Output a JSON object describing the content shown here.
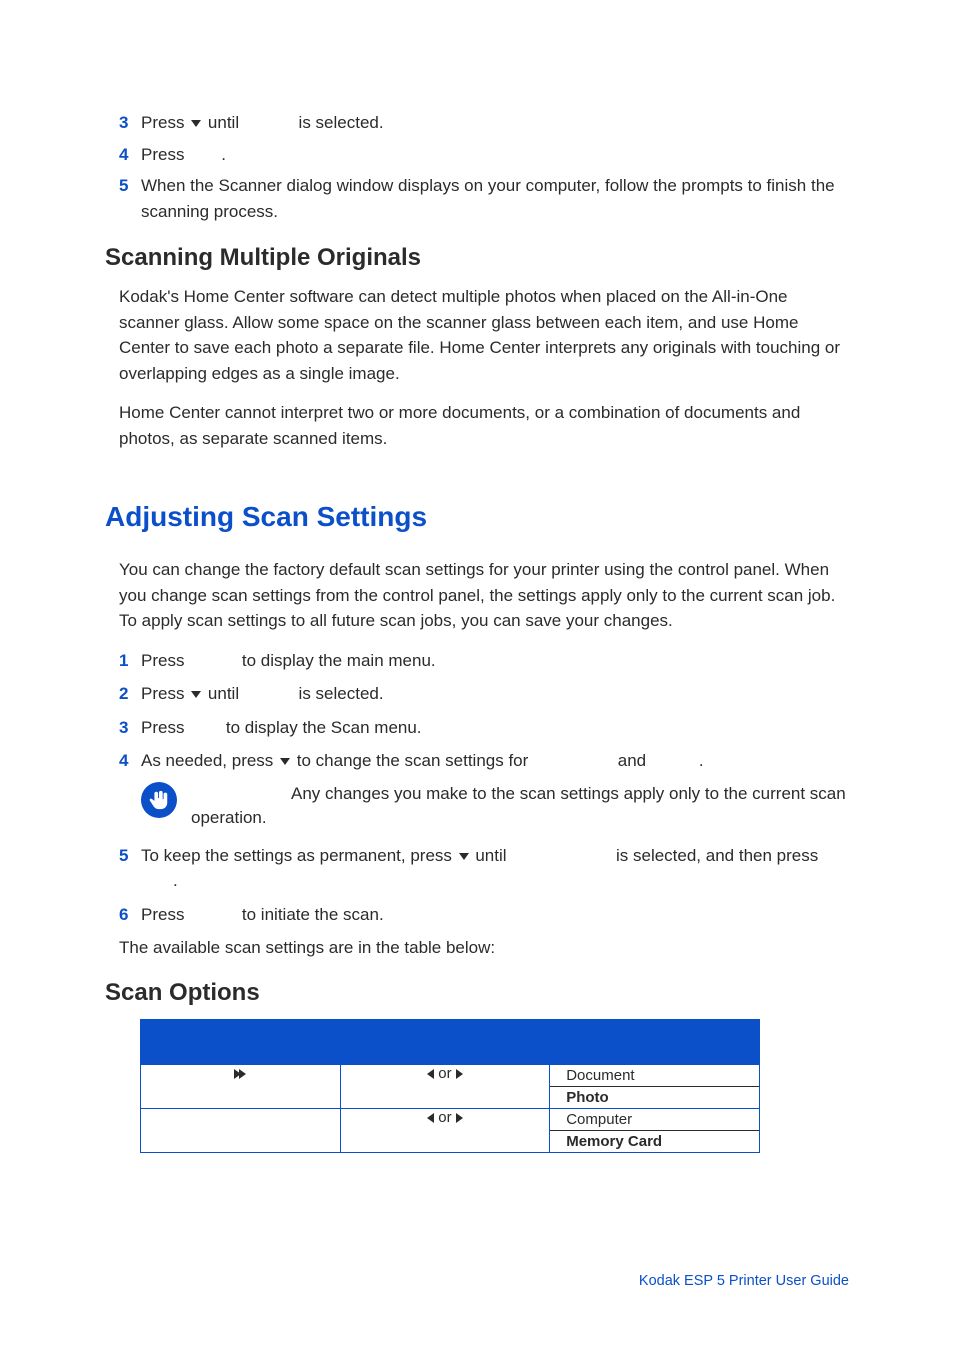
{
  "steps_top": {
    "s3_a": "Press ",
    "s3_b": " until ",
    "s3_c": " is selected.",
    "s4_a": "Press ",
    "s4_b": ".",
    "s5": "When the Scanner dialog window displays on your computer, follow the prompts to finish the scanning process."
  },
  "h_multi": "Scanning Multiple Originals",
  "p_multi_1": "Kodak's Home Center software can detect multiple photos when placed on the All-in-One scanner glass. Allow some space on the scanner glass between each item, and use Home Center to save each photo a separate file. Home Center interprets any originals with touching or overlapping edges as a single image.",
  "p_multi_2": "Home Center cannot interpret two or more documents, or a combination of documents and photos, as separate scanned items.",
  "h_adjust": "Adjusting Scan Settings",
  "p_adjust": "You can change the factory default scan settings for your printer using the control panel. When you change scan settings from the control panel, the settings apply only to the current scan job. To apply scan settings to all future scan jobs, you can save your changes.",
  "steps_adj": {
    "s1_a": "Press ",
    "s1_b": " to display the main menu.",
    "s2_a": "Press ",
    "s2_b": " until ",
    "s2_c": " is selected.",
    "s3_a": "Press ",
    "s3_b": " to display the Scan menu.",
    "s4_a": "As needed, press ",
    "s4_b": " to change the scan settings for ",
    "s4_c": " and ",
    "s4_d": ".",
    "s5_a": "To keep the settings as permanent, press ",
    "s5_b": " until ",
    "s5_c": " is selected, and then press ",
    "s5_d": ".",
    "s6_a": "Press ",
    "s6_b": " to initiate the scan."
  },
  "note_text": "Any changes you make to the scan settings apply only to the current scan operation.",
  "p_afterlist": "The available scan settings are in the table below:",
  "h_scanopt": "Scan Options",
  "table": {
    "or": " or ",
    "r1_opt1": "Document",
    "r1_opt2": "Photo",
    "r2_opt1": "Computer",
    "r2_opt2": "Memory Card"
  },
  "footer": "Kodak ESP 5 Printer User Guide"
}
